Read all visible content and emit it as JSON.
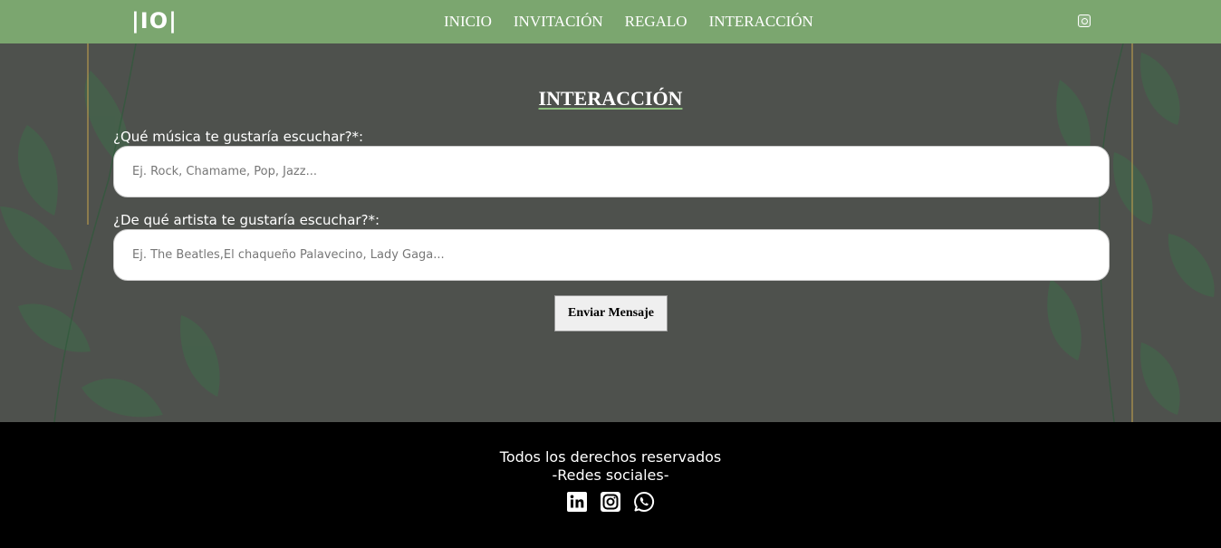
{
  "navbar": {
    "logo": "|IO|",
    "links": [
      "INICIO",
      "INVITACIÓN",
      "REGALO",
      "INTERACCIÓN"
    ],
    "icon": "instagram-icon"
  },
  "form": {
    "title": "INTERACCIÓN",
    "music_label": "¿Qué música te gustaría escuchar?*:",
    "music_placeholder": "Ej. Rock, Chamame, Pop, Jazz...",
    "music_value": "",
    "artist_label": "¿De qué artista te gustaría escuchar?*:",
    "artist_placeholder": "Ej. The Beatles,El chaqueño Palavecino, Lady Gaga...",
    "artist_value": "",
    "submit_label": "Enviar Mensaje"
  },
  "footer": {
    "rights": "Todos los derechos reservados",
    "social_heading": "-Redes sociales-",
    "social_icons": [
      "linkedin-icon",
      "instagram-icon",
      "whatsapp-icon"
    ]
  },
  "colors": {
    "navbar_bg": "#7ba66f",
    "main_bg": "#4e514d",
    "leaf": "#3f6c4a",
    "footer_bg": "#000000"
  }
}
